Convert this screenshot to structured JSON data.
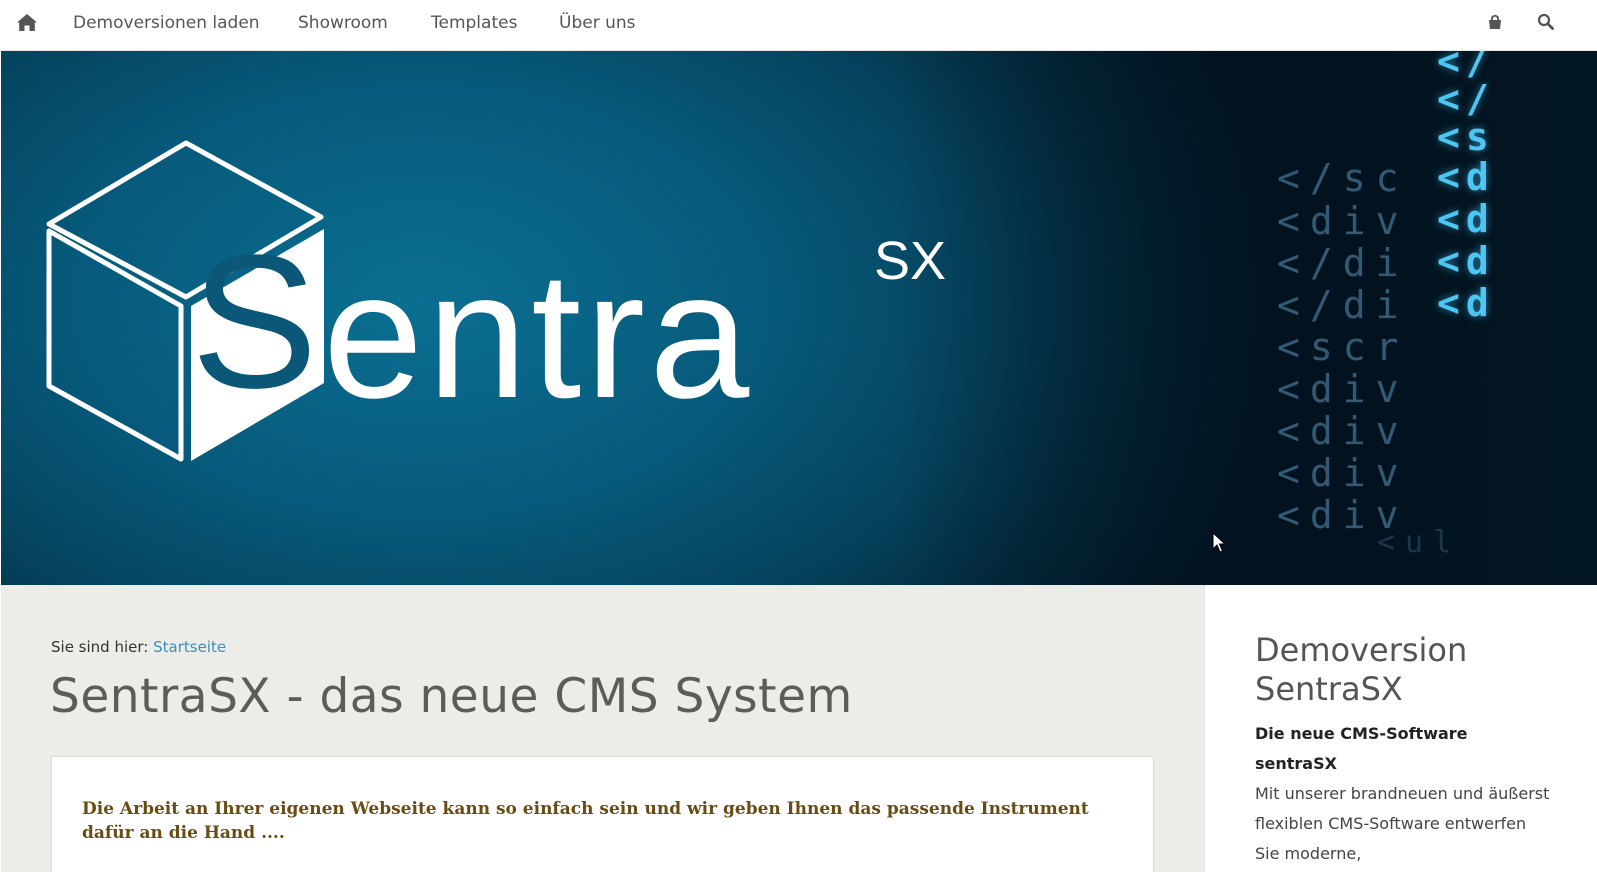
{
  "nav": {
    "home_icon": "home-icon",
    "items": [
      {
        "label": "Demoversionen laden"
      },
      {
        "label": "Showroom"
      },
      {
        "label": "Templates"
      },
      {
        "label": "Über uns"
      }
    ],
    "cart_icon": "shopping-bag-icon",
    "search_icon": "search-icon"
  },
  "hero": {
    "logo_text": "Sentra",
    "logo_superscript": "SX",
    "code_lines_dim": [
      "</sc",
      "<div",
      "</di",
      "</di",
      "<scr",
      "<div",
      "<div",
      "<div",
      "<div",
      "<ul"
    ],
    "code_lines_bright": [
      "</",
      "</",
      "<s",
      "<d",
      "<d",
      "<d",
      "<d"
    ]
  },
  "main": {
    "breadcrumb_prefix": "Sie sind hier:",
    "breadcrumb_link": "Startseite",
    "title": "SentraSX - das neue CMS System",
    "intro": "Die Arbeit an Ihrer eigenen Webseite kann so einfach sein und wir geben Ihnen das passende Instrument dafür an die Hand ...."
  },
  "sidebar": {
    "title": "Demoversion SentraSX",
    "subtitle": "Die neue CMS-Software sentraSX",
    "text": "Mit unserer brandneuen und äußerst flexiblen CMS-Software entwerfen Sie moderne,"
  },
  "colors": {
    "accent_link": "#3d8fbd",
    "hero_blue": "#075a7b",
    "intro_text": "#6a4b12",
    "main_bg": "#ecede8"
  }
}
